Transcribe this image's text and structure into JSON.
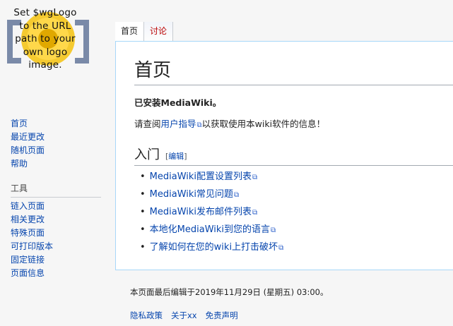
{
  "logo": {
    "text_lines": [
      "Set $wgLogo",
      "to the URL",
      "path to your",
      "own logo",
      "image."
    ]
  },
  "navigation": {
    "main": [
      "首页",
      "最近更改",
      "随机页面",
      "帮助"
    ],
    "tools_heading": "工具",
    "tools": [
      "链入页面",
      "相关更改",
      "特殊页面",
      "可打印版本",
      "固定链接",
      "页面信息"
    ]
  },
  "tabs": [
    {
      "label": "首页",
      "selected": true
    },
    {
      "label": "讨论",
      "selected": false
    }
  ],
  "content": {
    "title": "首页",
    "installed": "已安装MediaWiki。",
    "para_before": "请查阅",
    "para_link": "用户指导",
    "para_after": "以获取使用本wiki软件的信息！",
    "section_title": "入门",
    "edit_open": "[",
    "edit_label": "编辑",
    "edit_close": "]",
    "links": [
      "MediaWiki配置设置列表",
      "MediaWiki常见问题",
      "MediaWiki发布邮件列表",
      "本地化MediaWiki到您的语言",
      "了解如何在您的wiki上打击破坏"
    ]
  },
  "footer": {
    "last_edited": "本页面最后编辑于2019年11月29日 (星期五) 03:00。",
    "links": [
      "隐私政策",
      "关于xx",
      "免责声明"
    ]
  },
  "colors": {
    "link": "#0645ad",
    "border_blue": "#a7d7f9",
    "logo_bracket": "#7a8aa8",
    "logo_flower": "#f4c20d"
  }
}
